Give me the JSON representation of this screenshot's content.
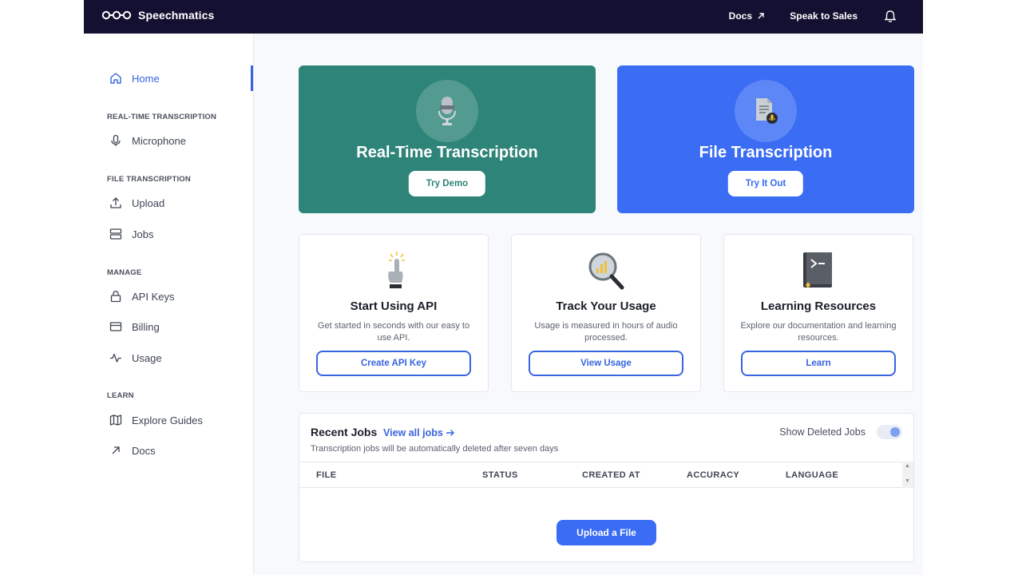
{
  "topbar": {
    "logo_text": "Speechmatics",
    "docs_label": "Docs",
    "sales_label": "Speak to Sales"
  },
  "sidebar": {
    "home": "Home",
    "section_realtime": "REAL-TIME TRANSCRIPTION",
    "microphone": "Microphone",
    "section_file": "FILE TRANSCRIPTION",
    "upload": "Upload",
    "jobs": "Jobs",
    "section_manage": "MANAGE",
    "api_keys": "API Keys",
    "billing": "Billing",
    "usage": "Usage",
    "section_learn": "LEARN",
    "explore_guides": "Explore Guides",
    "docs": "Docs"
  },
  "hero": {
    "realtime_title": "Real-Time Transcription",
    "realtime_button": "Try Demo",
    "file_title": "File Transcription",
    "file_button": "Try It Out"
  },
  "cards": [
    {
      "title": "Start Using API",
      "desc": "Get started in seconds with our easy to use API.",
      "button": "Create API Key",
      "icon": "pointer-hand-icon"
    },
    {
      "title": "Track Your Usage",
      "desc": "Usage is measured in hours of audio processed.",
      "button": "View Usage",
      "icon": "magnifier-chart-icon"
    },
    {
      "title": "Learning Resources",
      "desc": "Explore our documentation and learning resources.",
      "button": "Learn",
      "icon": "terminal-book-icon"
    }
  ],
  "jobs": {
    "title": "Recent Jobs",
    "view_all": "View all jobs",
    "subtitle": "Transcription jobs will be automatically deleted after seven days",
    "show_deleted": "Show Deleted Jobs",
    "columns": [
      "FILE",
      "STATUS",
      "CREATED AT",
      "ACCURACY",
      "LANGUAGE"
    ],
    "upload_button": "Upload a File"
  },
  "colors": {
    "topbar": "#141031",
    "accent": "#3864e0",
    "green": "#2e8478",
    "blue": "#3a6cf4"
  }
}
